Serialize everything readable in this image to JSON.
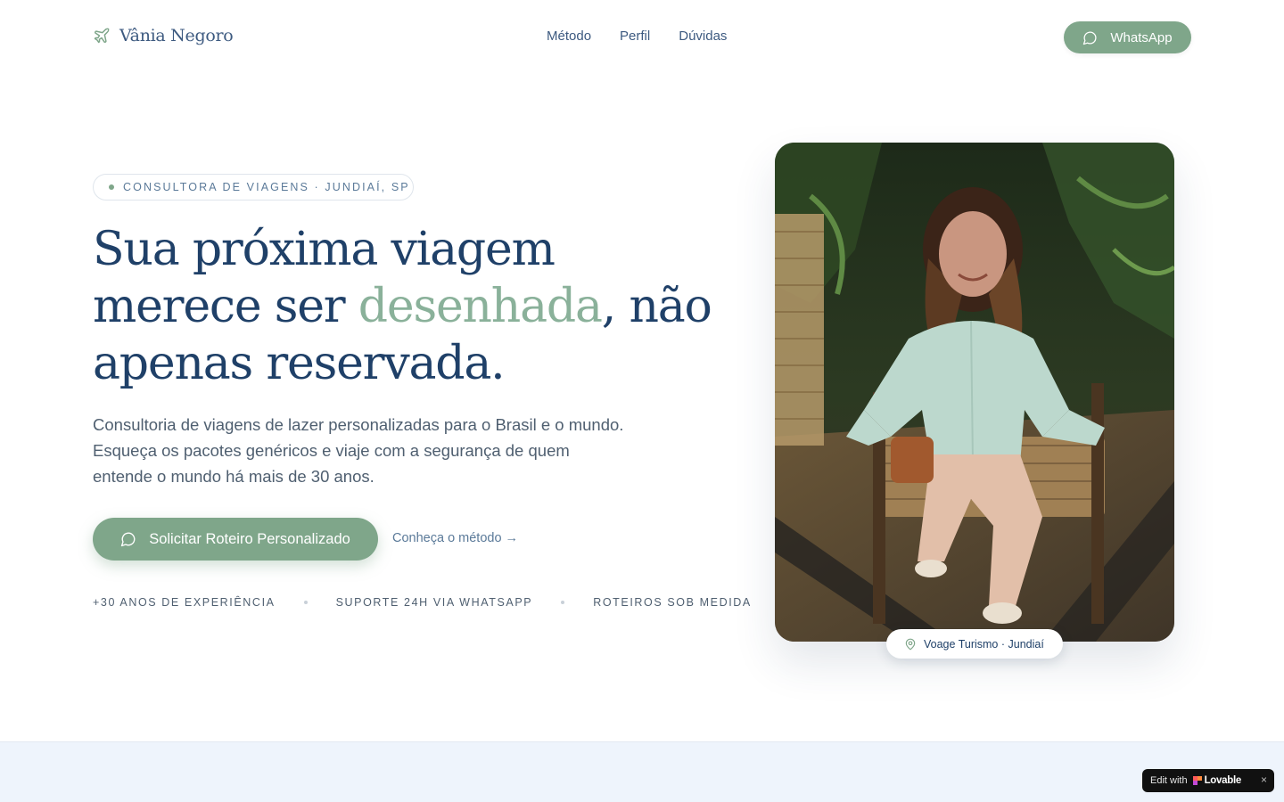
{
  "header": {
    "brand_name": "Vânia Negoro",
    "brand_icon": "plane-icon",
    "nav": [
      "Método",
      "Perfil",
      "Dúvidas"
    ],
    "whatsapp_label": "WhatsApp",
    "whatsapp_icon": "chat-bubble-icon"
  },
  "hero": {
    "badge": "CONSULTORA DE VIAGENS · JUNDIAÍ, SP",
    "headline_part1": "Sua próxima viagem merece ser ",
    "headline_accent": "desenhada",
    "headline_part2": ", não apenas reservada.",
    "lead": "Consultoria de viagens de lazer personalizadas para o Brasil e o mundo. Esqueça os pacotes genéricos e viaje com a segurança de quem entende o mundo há mais de 30 anos.",
    "cta_label": "Solicitar Roteiro Personalizado",
    "secondary_link": "Conheça o método →",
    "features": [
      "+30 ANOS DE EXPERIÊNCIA",
      "SUPORTE 24H VIA WHATSAPP",
      "ROTEIROS SOB MEDIDA"
    ],
    "location_label": "Voage Turismo · Jundiaí",
    "location_icon": "map-pin-icon"
  },
  "lovable_badge": {
    "edit_label": "Edit with",
    "brand": "Lovable",
    "close": "×"
  },
  "colors": {
    "primary_navy": "#1f4068",
    "accent_green": "#7fa68a",
    "accent_light_green": "#8ab19a",
    "section_bg": "#eef4fc"
  }
}
